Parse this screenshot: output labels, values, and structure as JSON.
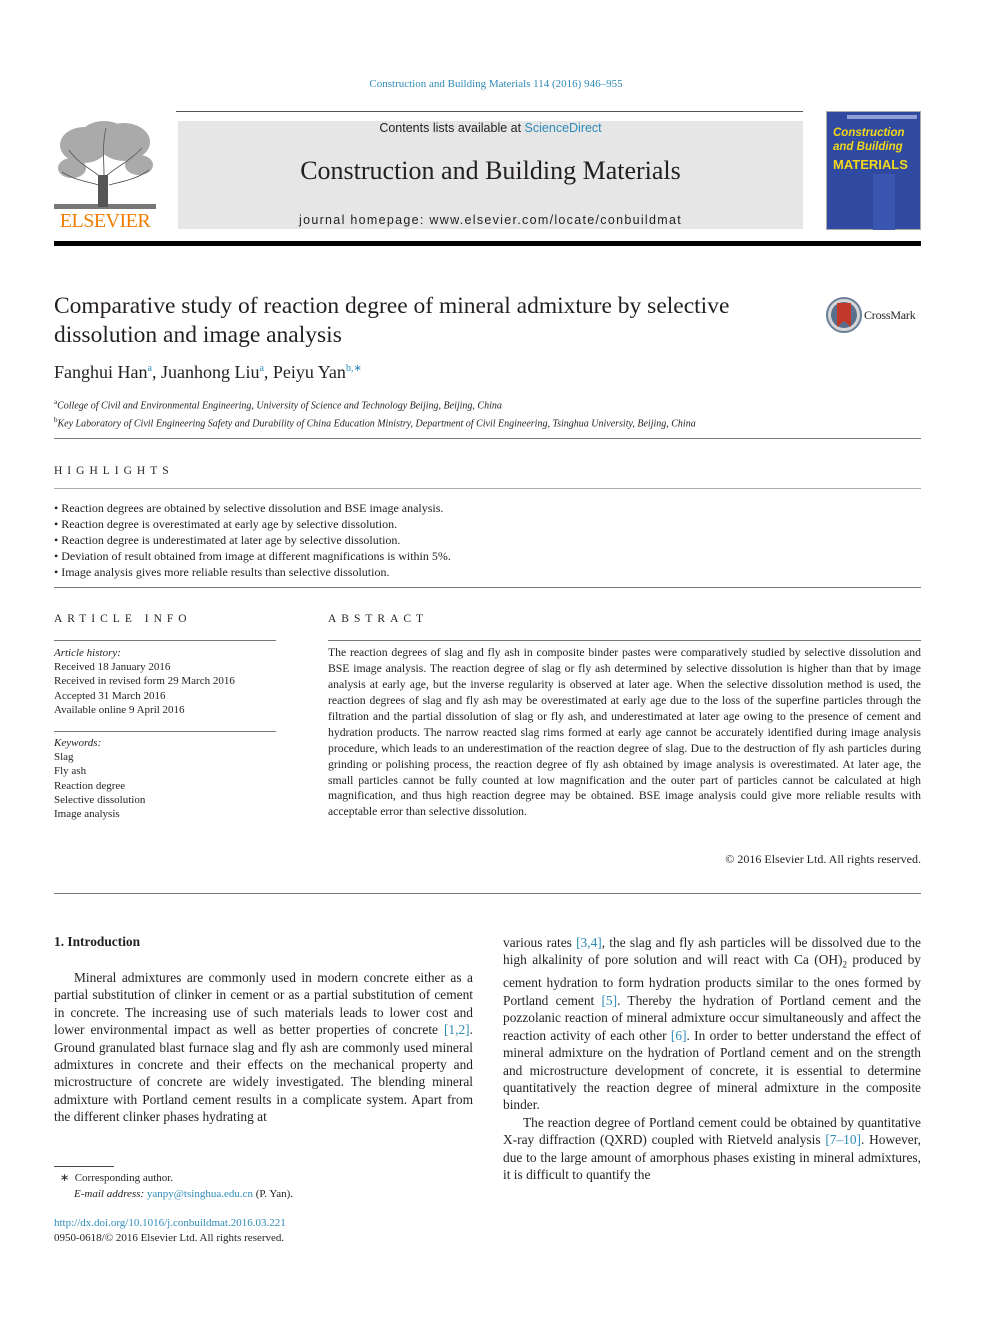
{
  "header": {
    "journal_ref": "Construction and Building Materials 114 (2016) 946–955",
    "contents_prefix": "Contents lists available at ",
    "contents_link": "ScienceDirect",
    "journal_title": "Construction and Building Materials",
    "homepage": "journal homepage: www.elsevier.com/locate/conbuildmat",
    "publisher_logo": "ELSEVIER",
    "cover": {
      "line1": "Construction",
      "line2": "and Building",
      "line3": "MATERIALS"
    },
    "crossmark": "CrossMark"
  },
  "article": {
    "title": "Comparative study of reaction degree of mineral admixture by selective dissolution and image analysis",
    "authors": [
      {
        "name": "Fanghui Han",
        "sup": "a"
      },
      {
        "name": "Juanhong Liu",
        "sup": "a"
      },
      {
        "name": "Peiyu Yan",
        "sup": "b,∗"
      }
    ],
    "affiliations": [
      {
        "mark": "a",
        "text": "College of Civil and Environmental Engineering, University of Science and Technology Beijing, Beijing, China"
      },
      {
        "mark": "b",
        "text": "Key Laboratory of Civil Engineering Safety and Durability of China Education Ministry, Department of Civil Engineering, Tsinghua University, Beijing, China"
      }
    ]
  },
  "highlights": {
    "heading": "HIGHLIGHTS",
    "items": [
      "Reaction degrees are obtained by selective dissolution and BSE image analysis.",
      "Reaction degree is overestimated at early age by selective dissolution.",
      "Reaction degree is underestimated at later age by selective dissolution.",
      "Deviation of result obtained from image at different magnifications is within 5%.",
      "Image analysis gives more reliable results than selective dissolution."
    ]
  },
  "article_info": {
    "heading": "ARTICLE INFO",
    "history_label": "Article history:",
    "history": [
      "Received 18 January 2016",
      "Received in revised form 29 March 2016",
      "Accepted 31 March 2016",
      "Available online 9 April 2016"
    ],
    "keywords_label": "Keywords:",
    "keywords": [
      "Slag",
      "Fly ash",
      "Reaction degree",
      "Selective dissolution",
      "Image analysis"
    ]
  },
  "abstract": {
    "heading": "ABSTRACT",
    "text": "The reaction degrees of slag and fly ash in composite binder pastes were comparatively studied by selective dissolution and BSE image analysis. The reaction degree of slag or fly ash determined by selective dissolution is higher than that by image analysis at early age, but the inverse regularity is observed at later age. When the selective dissolution method is used, the reaction degrees of slag and fly ash may be overestimated at early age due to the loss of the superfine particles through the filtration and the partial dissolution of slag or fly ash, and underestimated at later age owing to the presence of cement and hydration products. The narrow reacted slag rims formed at early age cannot be accurately identified during image analysis procedure, which leads to an underestimation of the reaction degree of slag. Due to the destruction of fly ash particles during grinding or polishing process, the reaction degree of fly ash obtained by image analysis is overestimated. At later age, the small particles cannot be fully counted at low magnification and the outer part of particles cannot be calculated at high magnification, and thus high reaction degree may be obtained. BSE image analysis could give more reliable results with acceptable error than selective dissolution.",
    "copyright": "© 2016 Elsevier Ltd. All rights reserved."
  },
  "introduction": {
    "heading": "1. Introduction",
    "col1": {
      "p1_a": "Mineral admixtures are commonly used in modern concrete either as a partial substitution of clinker in cement or as a partial substitution of cement in concrete. The increasing use of such materials leads to lower cost and lower environmental impact as well as better properties of concrete ",
      "ref1": "[1,2]",
      "p1_b": ". Ground granulated blast furnace slag and fly ash are commonly used mineral admixtures in concrete and their effects on the mechanical property and microstructure of concrete are widely investigated. The blending mineral admixture with Portland cement results in a complicate system. Apart from the different clinker phases hydrating at"
    },
    "col2": {
      "p1_a": "various rates ",
      "ref1": "[3,4]",
      "p1_b": ", the slag and fly ash particles will be dissolved due to the high alkalinity of pore solution and will react with Ca (OH)",
      "sub": "2",
      "p1_c": " produced by cement hydration to form hydration products similar to the ones formed by Portland cement ",
      "ref2": "[5]",
      "p1_d": ". Thereby the hydration of Portland cement and the pozzolanic reaction of mineral admixture occur simultaneously and affect the reaction activity of each other ",
      "ref3": "[6]",
      "p1_e": ". In order to better understand the effect of mineral admixture on the hydration of Portland cement and on the strength and microstructure development of concrete, it is essential to determine quantitatively the reaction degree of mineral admixture in the composite binder.",
      "p2_a": "The reaction degree of Portland cement could be obtained by quantitative X-ray diffraction (QXRD) coupled with Rietveld analysis ",
      "ref4": "[7–10]",
      "p2_b": ". However, due to the large amount of amorphous phases existing in mineral admixtures, it is difficult to quantify the"
    }
  },
  "footnote": {
    "mark": "∗",
    "corresponding": "Corresponding author.",
    "email_label": "E-mail address:",
    "email": "yanpy@tsinghua.edu.cn",
    "email_suffix": " (P. Yan)."
  },
  "doi": {
    "link": "http://dx.doi.org/10.1016/j.conbuildmat.2016.03.221",
    "issn_line": "0950-0618/© 2016 Elsevier Ltd. All rights reserved."
  }
}
